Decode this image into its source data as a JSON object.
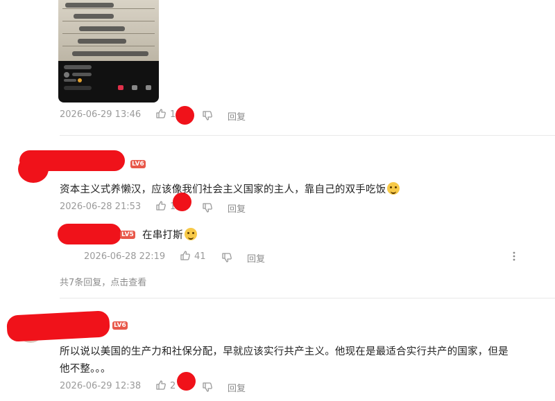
{
  "comments": [
    {
      "timestamp": "2026-06-29 13:46",
      "likes_partial": "1",
      "reply_label": "回复"
    },
    {
      "level": "LV6",
      "text": "资本主义式养懒汉，应该像我们社会主义国家的主人，靠自己的双手吃饭",
      "avatar_caption": "",
      "timestamp": "2026-06-28 21:53",
      "likes_partial": "1",
      "reply_label": "回复",
      "reply": {
        "level": "LV5",
        "text": "在串打斯",
        "timestamp": "2026-06-28 22:19",
        "likes": "41",
        "reply_label": "回复"
      },
      "more_replies": "共7条回复，点击查看"
    },
    {
      "level": "LV6",
      "text_line1": "所以说以美国的生产力和社保分配，早就应该实行共产主义。他现在是最适合实行共产的国家，但是",
      "text_line2": "他不整。。。",
      "timestamp": "2026-06-29 12:38",
      "likes_partial": "2",
      "reply_label": "回复"
    }
  ],
  "colors": {
    "redaction": "#f0121a",
    "level_badge": "#e8584a",
    "meta_text": "#9a9a9a"
  },
  "icons": [
    "thumbs-up-icon",
    "thumbs-down-icon",
    "more-vertical-icon"
  ]
}
